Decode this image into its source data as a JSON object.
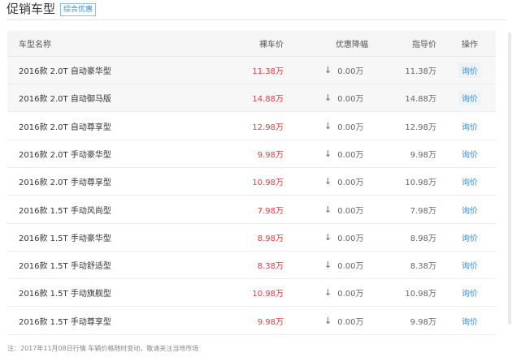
{
  "header": {
    "title": "促销车型",
    "tag": "综合优惠"
  },
  "table": {
    "columns": {
      "name": "车型名称",
      "price": "裸车价",
      "discount": "优惠降幅",
      "guide": "指导价",
      "op": "操作"
    },
    "arrow_icon": "down-arrow-icon",
    "rows": [
      {
        "name": "2016款 2.0T 自动豪华型",
        "price": "11.38万",
        "discount": "0.00万",
        "guide": "11.38万",
        "op": "询价"
      },
      {
        "name": "2016款 2.0T 自动御马版",
        "price": "14.88万",
        "discount": "0.00万",
        "guide": "14.88万",
        "op": "询价"
      },
      {
        "name": "2016款 2.0T 自动尊享型",
        "price": "12.98万",
        "discount": "0.00万",
        "guide": "12.98万",
        "op": "询价"
      },
      {
        "name": "2016款 2.0T 手动豪华型",
        "price": "9.98万",
        "discount": "0.00万",
        "guide": "9.98万",
        "op": "询价"
      },
      {
        "name": "2016款 2.0T 手动尊享型",
        "price": "10.98万",
        "discount": "0.00万",
        "guide": "10.98万",
        "op": "询价"
      },
      {
        "name": "2016款 1.5T 手动风尚型",
        "price": "7.98万",
        "discount": "0.00万",
        "guide": "7.98万",
        "op": "询价"
      },
      {
        "name": "2016款 1.5T 手动豪华型",
        "price": "8.98万",
        "discount": "0.00万",
        "guide": "8.98万",
        "op": "询价"
      },
      {
        "name": "2016款 1.5T 手动舒适型",
        "price": "8.38万",
        "discount": "0.00万",
        "guide": "8.38万",
        "op": "询价"
      },
      {
        "name": "2016款 1.5T 手动旗舰型",
        "price": "10.98万",
        "discount": "0.00万",
        "guide": "10.98万",
        "op": "询价"
      },
      {
        "name": "2016款 1.5T 手动尊享型",
        "price": "9.98万",
        "discount": "0.00万",
        "guide": "9.98万",
        "op": "询价"
      }
    ]
  },
  "footer": {
    "note": "注：2017年11月08日行情 车辆价格随时变动，敬请关注当地市场"
  },
  "colors": {
    "price_red": "#e63c3c",
    "link_blue": "#3f8ed6",
    "header_bg": "#f5f5f5",
    "highlight_bg": "#f7f7f7"
  }
}
